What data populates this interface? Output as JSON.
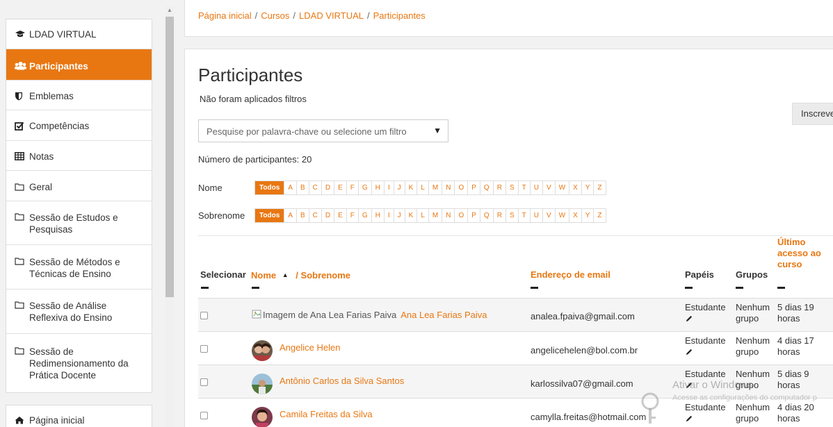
{
  "sidebar": {
    "items": [
      {
        "label": "LDAD VIRTUAL",
        "icon": "graduation-cap-icon"
      },
      {
        "label": "Participantes",
        "icon": "users-icon",
        "active": true
      },
      {
        "label": "Emblemas",
        "icon": "shield-icon"
      },
      {
        "label": "Competências",
        "icon": "checkbox-icon"
      },
      {
        "label": "Notas",
        "icon": "table-icon"
      },
      {
        "label": "Geral",
        "icon": "folder-icon"
      },
      {
        "label": "Sessão de Estudos e Pesquisas",
        "icon": "folder-icon"
      },
      {
        "label": "Sessão de Métodos e Técnicas de Ensino",
        "icon": "folder-icon"
      },
      {
        "label": "Sessão de Análise Reflexiva do Ensino",
        "icon": "folder-icon"
      },
      {
        "label": "Sessão de Redimensionamento da Prática Docente",
        "icon": "folder-icon"
      }
    ],
    "home": {
      "label": "Página inicial",
      "icon": "home-icon"
    }
  },
  "breadcrumb": [
    "Página inicial",
    "Cursos",
    "LDAD VIRTUAL",
    "Participantes"
  ],
  "main": {
    "title": "Participantes",
    "filter_status": "Não foram aplicados filtros",
    "enroll_button": "Inscreve",
    "search_placeholder": "Pesquise por palavra-chave ou selecione um filtro",
    "participant_count": "Número de participantes: 20",
    "initials_first_label": "Nome",
    "initials_last_label": "Sobrenome",
    "initials_all": "Todos",
    "letters": [
      "A",
      "B",
      "C",
      "D",
      "E",
      "F",
      "G",
      "H",
      "I",
      "J",
      "K",
      "L",
      "M",
      "N",
      "O",
      "P",
      "Q",
      "R",
      "S",
      "T",
      "U",
      "V",
      "W",
      "X",
      "Y",
      "Z"
    ]
  },
  "table": {
    "headers": {
      "select": "Selecionar",
      "name": "Nome",
      "sort_indicator": "▲",
      "surname": "/ Sobrenome",
      "email": "Endereço de email",
      "roles": "Papéis",
      "groups": "Grupos",
      "last_access_1": "Último",
      "last_access_2": "acesso ao",
      "last_access_3": "curso"
    },
    "rows": [
      {
        "image_alt": "Imagem de Ana Lea Farias Paiva",
        "name": "Ana Lea Farias Paiva",
        "email": "analea.fpaiva@gmail.com",
        "role": "Estudante",
        "group_1": "Nenhum",
        "group_2": "grupo",
        "access_1": "5 dias 19",
        "access_2": "horas"
      },
      {
        "name": "Angelice Helen",
        "email": "angelicehelen@bol.com.br",
        "role": "Estudante",
        "group_1": "Nenhum",
        "group_2": "grupo",
        "access_1": "4 dias 17",
        "access_2": "horas"
      },
      {
        "name": "Antônio Carlos da Silva Santos",
        "email": "karlossilva07@gmail.com",
        "role": "Estudante",
        "group_1": "Nenhum",
        "group_2": "grupo",
        "access_1": "5 dias 9",
        "access_2": "horas"
      },
      {
        "name": "Camila Freitas da Silva",
        "email": "camylla.freitas@hotmail.com",
        "role": "Estudante",
        "group_1": "Nenhum",
        "group_2": "grupo",
        "access_1": "4 dias 20",
        "access_2": "horas"
      }
    ]
  },
  "watermark": {
    "title": "Ativar o Windows",
    "subtitle": "Acesse as configurações do computador p"
  },
  "colors": {
    "accent": "#e87712"
  }
}
